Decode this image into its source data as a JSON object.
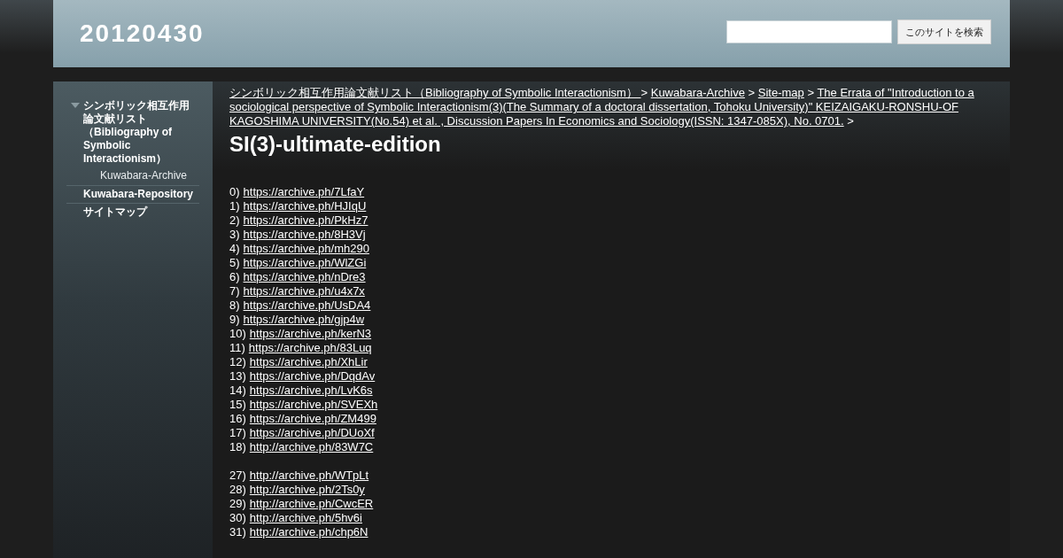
{
  "site_title": "20120430",
  "search": {
    "button": "このサイトを検索"
  },
  "sidebar": {
    "items": [
      {
        "label": "シンボリック相互作用論文献リスト（Bibliography of Symbolic Interactionism）",
        "expanded": true,
        "children": [
          {
            "label": "Kuwabara-Archive"
          }
        ]
      },
      {
        "label": "Kuwabara-Repository"
      },
      {
        "label": "サイトマップ"
      }
    ]
  },
  "breadcrumb": [
    {
      "kind": "link",
      "text": "シンボリック相互作用論文献リスト（Bibliography of Symbolic Interactionism） "
    },
    {
      "kind": "separator",
      "text": ">"
    },
    {
      "kind": "link",
      "text": "Kuwabara-Archive"
    },
    {
      "kind": "separator",
      "text": ">"
    },
    {
      "kind": "link",
      "text": "Site-map"
    },
    {
      "kind": "separator",
      "text": ">"
    },
    {
      "kind": "link",
      "text": "The Errata of \"Introduction to a sociological perspective of Symbolic Interactionism(3)(The Summary of a doctoral dissertation, Tohoku University)\" KEIZAIGAKU-RONSHU-OF KAGOSHIMA UNIVERSITY(No.54) et al. , Discussion Papers In Economics and Sociology(ISSN: 1347-085X), No. 0701."
    },
    {
      "kind": "separator",
      "text": ">"
    }
  ],
  "page_title": "SI(3)-ultimate-edition",
  "link_groups": [
    [
      {
        "number": "0)",
        "url": "https://archive.ph/7LfaY"
      },
      {
        "number": "1)",
        "url": "https://archive.ph/HJIqU"
      },
      {
        "number": "2)",
        "url": "https://archive.ph/PkHz7"
      },
      {
        "number": "3)",
        "url": "https://archive.ph/8H3Vj"
      },
      {
        "number": "4)",
        "url": "https://archive.ph/mh290"
      },
      {
        "number": "5)",
        "url": "https://archive.ph/WlZGi"
      },
      {
        "number": "6)",
        "url": "https://archive.ph/nDre3"
      },
      {
        "number": "7)",
        "url": "https://archive.ph/u4x7x"
      },
      {
        "number": "8)",
        "url": "https://archive.ph/UsDA4"
      },
      {
        "number": "9)",
        "url": "https://archive.ph/gjp4w"
      },
      {
        "number": "10)",
        "url": "https://archive.ph/kerN3"
      },
      {
        "number": "11)",
        "url": "https://archive.ph/83Luq"
      },
      {
        "number": "12)",
        "url": "https://archive.ph/XhLir"
      },
      {
        "number": "13)",
        "url": "https://archive.ph/DqdAv"
      },
      {
        "number": "14)",
        "url": "https://archive.ph/LvK6s"
      },
      {
        "number": "15)",
        "url": "https://archive.ph/SVEXh"
      },
      {
        "number": "16)",
        "url": "https://archive.ph/ZM499"
      },
      {
        "number": "17)",
        "url": "https://archive.ph/DUoXf"
      },
      {
        "number": "18)",
        "url": "http://archive.ph/83W7C"
      }
    ],
    [
      {
        "number": "27)",
        "url": "http://archive.ph/WTpLt"
      },
      {
        "number": "28)",
        "url": "http://archive.ph/2Ts0y"
      },
      {
        "number": "29)",
        "url": "http://archive.ph/CwcER"
      },
      {
        "number": "30)",
        "url": "http://archive.ph/5hv6i"
      },
      {
        "number": "31)",
        "url": "http://archive.ph/chp6N"
      }
    ]
  ]
}
